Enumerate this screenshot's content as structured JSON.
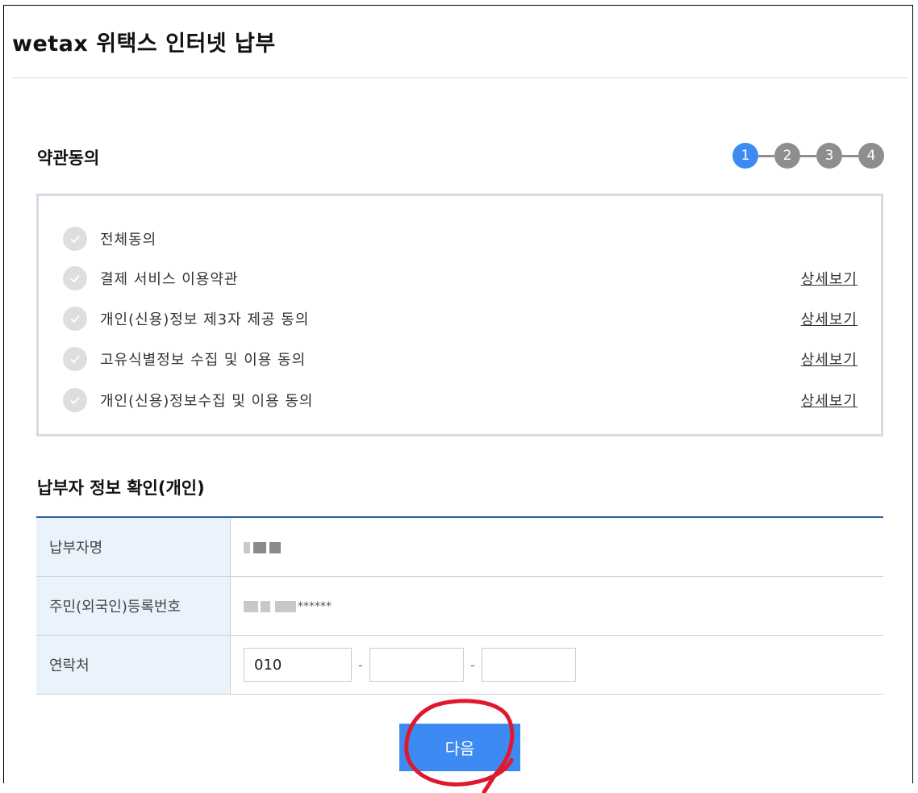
{
  "page": {
    "title": "wetax 위택스 인터넷 납부"
  },
  "terms_section": {
    "title": "약관동의",
    "steps": [
      "1",
      "2",
      "3",
      "4"
    ],
    "active_step": 1,
    "items": [
      {
        "label": "전체동의",
        "link": ""
      },
      {
        "label": "결제 서비스 이용약관",
        "link": "상세보기"
      },
      {
        "label": "개인(신용)정보 제3자 제공 동의",
        "link": "상세보기"
      },
      {
        "label": "고유식별정보 수집 및 이용 동의",
        "link": "상세보기"
      },
      {
        "label": "개인(신용)정보수집 및 이용 동의",
        "link": "상세보기"
      }
    ]
  },
  "payer_section": {
    "title": "납부자 정보 확인(개인)",
    "rows": {
      "name": {
        "label": "납부자명"
      },
      "reg_number": {
        "label": "주민(외국인)등록번호",
        "masked_suffix": "******"
      },
      "phone": {
        "label": "연락처",
        "part1": "010",
        "part2": "",
        "part3": "",
        "separator": "-"
      }
    }
  },
  "next_button": {
    "label": "다음"
  },
  "colors": {
    "accent": "#3d8bf2",
    "step_inactive": "#8e8e8e",
    "table_top_border": "#2f5fa3",
    "label_cell_bg": "#eaf3fc",
    "annotation_circle": "#e0182d"
  }
}
